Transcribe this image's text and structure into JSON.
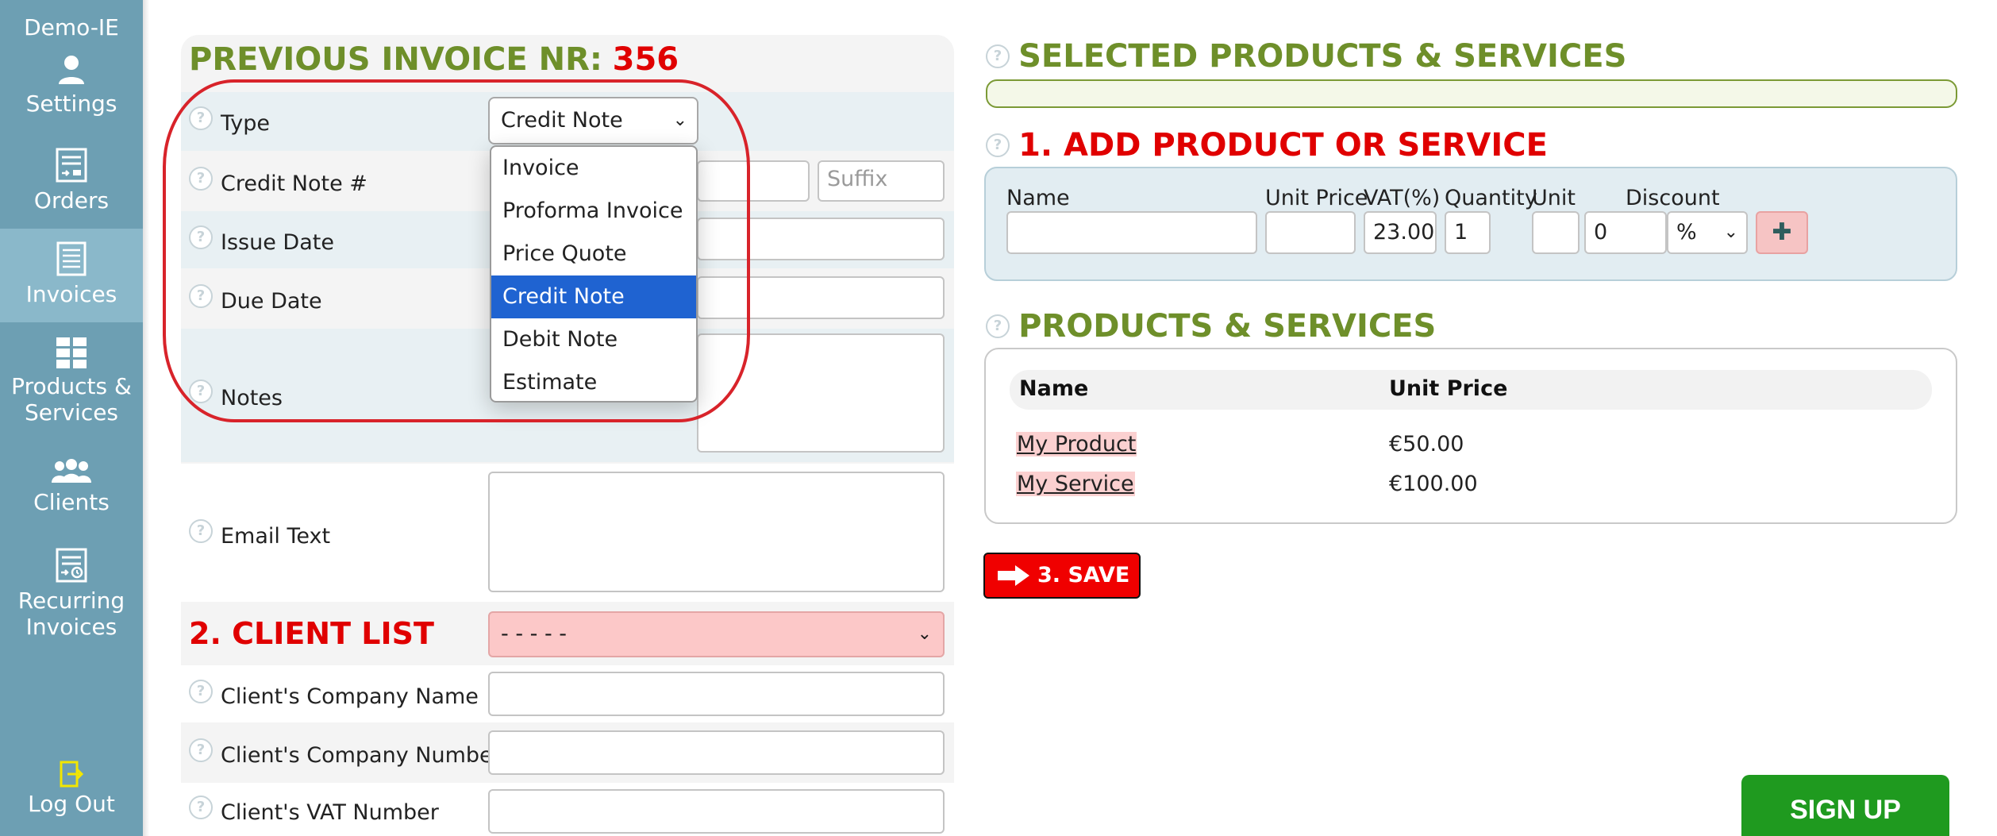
{
  "sidebar": {
    "brand": "Demo-IE",
    "items": [
      {
        "label": "Settings",
        "icon": "user-icon"
      },
      {
        "label": "Orders",
        "icon": "orders-icon"
      },
      {
        "label": "Invoices",
        "icon": "invoice-icon",
        "active": true
      },
      {
        "label": "Products &",
        "label2": "Services",
        "icon": "grid-icon"
      },
      {
        "label": "Clients",
        "icon": "clients-icon"
      },
      {
        "label": "Recurring",
        "label2": "Invoices",
        "icon": "recurring-icon"
      }
    ],
    "logout": "Log Out"
  },
  "form": {
    "prev_invoice_label": "PREVIOUS INVOICE NR:",
    "prev_invoice_nr": "356",
    "type_label": "Type",
    "type_value": "Credit Note",
    "type_options": [
      "Invoice",
      "Proforma Invoice",
      "Price Quote",
      "Credit Note",
      "Debit Note",
      "Estimate"
    ],
    "credit_note_label": "Credit Note #",
    "suffix_placeholder": "Suffix",
    "issue_date_label": "Issue Date",
    "due_date_label": "Due Date",
    "notes_label": "Notes",
    "email_text_label": "Email Text",
    "client_list_title": "2. CLIENT LIST",
    "client_select_value": "- - - - -",
    "company_name_label": "Client's Company Name",
    "company_number_label": "Client's Company Number",
    "vat_number_label": "Client's VAT Number"
  },
  "right": {
    "selected_title": "SELECTED PRODUCTS & SERVICES",
    "add_title": "1. ADD PRODUCT OR SERVICE",
    "fields": {
      "name": "Name",
      "unit_price": "Unit Price",
      "vat": "VAT(%)",
      "quantity": "Quantity",
      "unit": "Unit",
      "discount": "Discount"
    },
    "values": {
      "vat": "23.00",
      "quantity": "1",
      "discount": "0",
      "discount_type": "%"
    },
    "ps_title": "PRODUCTS & SERVICES",
    "ps_headers": {
      "name": "Name",
      "unit_price": "Unit Price"
    },
    "products": [
      {
        "name": "My Product",
        "price": "€50.00"
      },
      {
        "name": "My Service",
        "price": "€100.00"
      }
    ],
    "save_label": "3. SAVE",
    "signup_label": "SIGN UP"
  },
  "colors": {
    "sidebar": "#6d9fb3",
    "green_title": "#6e8f2a",
    "red_title": "#e00000",
    "selected_option": "#1f63d1",
    "signup": "#1f9a1f"
  }
}
